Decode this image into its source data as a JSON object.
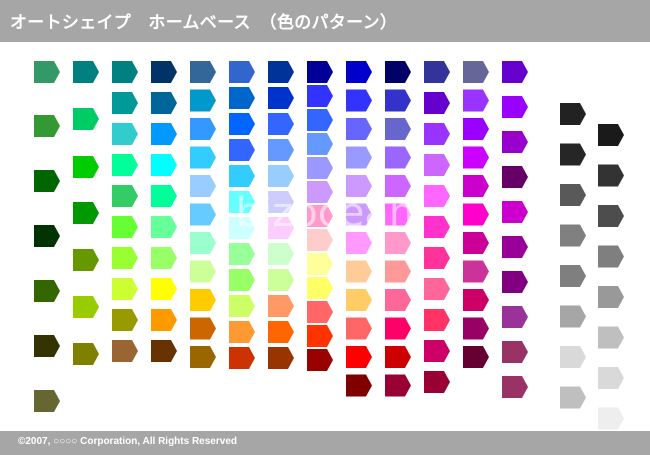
{
  "title": "オートシェイプ　ホームベース　（色のパターン）",
  "footer": "©2007, ○○○○ Corporation, All Rights Reserved",
  "watermark": "bizocean",
  "colors": {
    "bar": "#a6a6a6",
    "bar_text": "#ffffff",
    "background": "#ffffff"
  },
  "shape": "pentagon-home-plate",
  "palette": [
    [
      "#339966",
      "#339933",
      "#006600",
      "#003300",
      "#336600",
      "#333300",
      "#666633"
    ],
    [
      "#008080",
      "#00cc66",
      "#00cc00",
      "#009900",
      "#669900",
      "#99cc00",
      "#808000"
    ],
    [
      "#008080",
      "#009999",
      "#33cccc",
      "#00ff99",
      "#33cc66",
      "#66ff33",
      "#99ff33",
      "#ccff33",
      "#999900",
      "#996633"
    ],
    [
      "#003366",
      "#006699",
      "#0099ff",
      "#00ffff",
      "#00ff99",
      "#66ff99",
      "#99ff66",
      "#ffff00",
      "#ff9900",
      "#663300"
    ],
    [
      "#336699",
      "#0099cc",
      "#3399ff",
      "#33ccff",
      "#99ccff",
      "#66ccff",
      "#99ffcc",
      "#ccff99",
      "#ffcc00",
      "#cc6600",
      "#996600"
    ],
    [
      "#3366cc",
      "#0066cc",
      "#0066ff",
      "#3366ff",
      "#33ccff",
      "#66ffff",
      "#ccffff",
      "#99ff99",
      "#99ff66",
      "#ccff66",
      "#ff9933",
      "#cc3300"
    ],
    [
      "#003399",
      "#0033cc",
      "#3366ff",
      "#6699ff",
      "#99ccff",
      "#ccccff",
      "#ffccff",
      "#ccffcc",
      "#ccff99",
      "#ff9966",
      "#ff6600",
      "#993300"
    ],
    [
      "#000099",
      "#3333ff",
      "#3366ff",
      "#6699ff",
      "#9999ff",
      "#cc99ff",
      "#ff99cc",
      "#ffcccc",
      "#ffff99",
      "#ffff66",
      "#ff6666",
      "#ff3300",
      "#990000"
    ],
    [
      "#0000cc",
      "#3333ff",
      "#6666ff",
      "#9999ff",
      "#cc99ff",
      "#cc99ff",
      "#ff99ff",
      "#ffcc99",
      "#ffcc66",
      "#ff6666",
      "#ff0000",
      "#800000"
    ],
    [
      "#000066",
      "#3333cc",
      "#6666cc",
      "#9966ff",
      "#cc66ff",
      "#ff66ff",
      "#ff99cc",
      "#ff9999",
      "#ff6699",
      "#ff0066",
      "#cc0000",
      "#990033"
    ],
    [
      "#333399",
      "#6600cc",
      "#9933ff",
      "#cc66ff",
      "#ff66ff",
      "#ff33cc",
      "#ff3399",
      "#ff6699",
      "#ff3366",
      "#cc0066",
      "#990033"
    ],
    [
      "#666699",
      "#9933ff",
      "#9900ff",
      "#cc00ff",
      "#cc00cc",
      "#ff00cc",
      "#cc0099",
      "#cc3399",
      "#cc0066",
      "#990066",
      "#660033"
    ],
    [
      "#6600cc",
      "#9900ff",
      "#9900cc",
      "#660066",
      "#cc00cc",
      "#990099",
      "#800080",
      "#993399",
      "#993366",
      "#993366"
    ],
    [
      "#222222",
      "#262626",
      "#595959",
      "#808080",
      "#7f7f7f",
      "#a6a6a6",
      "#d9d9d9",
      "#bfbfbf"
    ],
    [
      "#1a1a1a",
      "#333333",
      "#4d4d4d",
      "#7f7f7f",
      "#999999",
      "#bfbfbf",
      "#d9d9d9",
      "#eeeeee"
    ]
  ]
}
